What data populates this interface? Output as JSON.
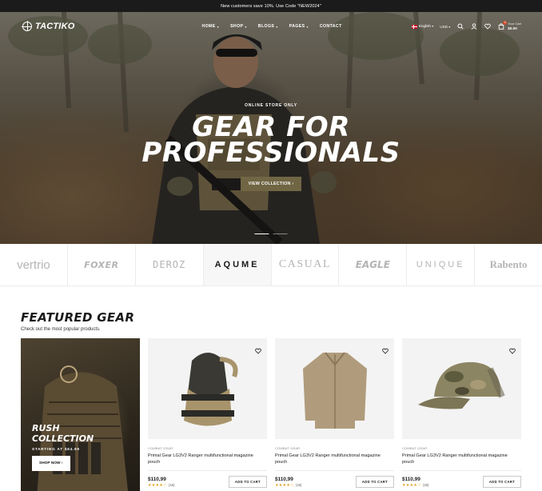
{
  "announcement": "New customers save 10%. Use Code \"NEW2024\"",
  "nav": {
    "logo": "TACTIKO",
    "menu": [
      "HOME",
      "SHOP",
      "BLOGS",
      "PAGES",
      "CONTACT"
    ],
    "language": "English",
    "currency": "USD",
    "cart_label": "Your Cart",
    "cart_amount": "$0.00",
    "cart_count": "0"
  },
  "hero": {
    "eyebrow": "ONLINE STORE ONLY",
    "title_line1": "GEAR FOR",
    "title_line2": "PROFESSIONALS",
    "button": "VIEW COLLECTION",
    "button_arrow": "›"
  },
  "brands": [
    "vertrio",
    "FOXER",
    "DEROZ",
    "AQUME",
    "CASUAL",
    "EAGLE",
    "UNIQUE",
    "Rabento"
  ],
  "featured": {
    "title": "FEATURED GEAR",
    "subtitle": "Check out the most popular products.",
    "promo": {
      "title_line1": "RUSH",
      "title_line2": "COLLECTION",
      "subtitle": "STARTING AT $64.99",
      "button": "SHOP NOW",
      "button_arrow": "›"
    },
    "products": [
      {
        "category": "COMBAT GEAR",
        "name": "Primal Gear LG3V2 Ranger multifunctional magazine pouch",
        "price": "$110,99",
        "stars": "★★★★☆",
        "reviews": "(15)",
        "button": "ADD TO CART"
      },
      {
        "category": "COMBAT GEAR",
        "name": "Primal Gear LG3V2 Ranger multifunctional magazine pouch",
        "price": "$110,99",
        "stars": "★★★★☆",
        "reviews": "(15)",
        "button": "ADD TO CART"
      },
      {
        "category": "COMBAT GEAR",
        "name": "Primal Gear LG3V2 Ranger multifunctional magazine pouch",
        "price": "$110,99",
        "stars": "★★★★☆",
        "reviews": "(15)",
        "button": "ADD TO CART"
      }
    ]
  },
  "colors": {
    "accent": "#706644",
    "dark": "#1b1b1b",
    "star": "#e0a21b",
    "badge": "#d4482d"
  }
}
